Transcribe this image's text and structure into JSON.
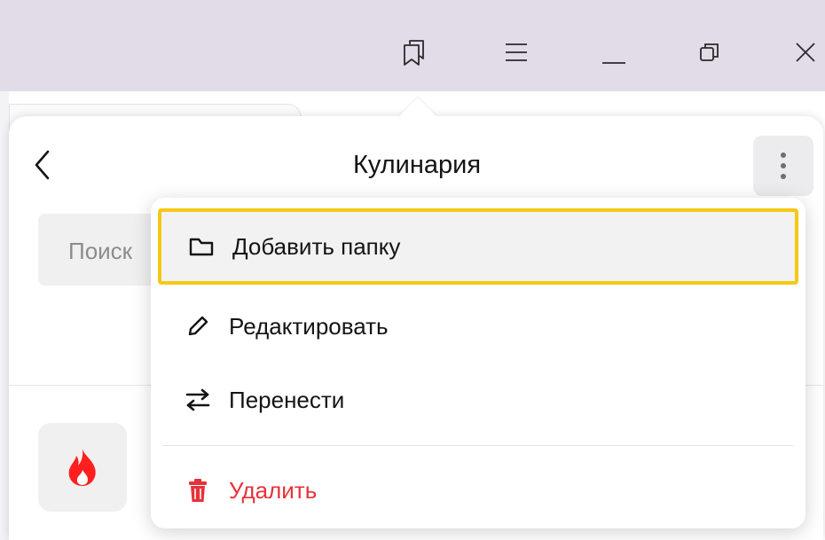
{
  "titlebar": {
    "buttons": [
      {
        "name": "bookmarks-icon"
      },
      {
        "name": "menu-icon"
      },
      {
        "name": "minimize-icon"
      },
      {
        "name": "restore-icon"
      },
      {
        "name": "close-icon"
      }
    ]
  },
  "panel": {
    "title": "Кулинария",
    "search": {
      "placeholder": "Поиск"
    }
  },
  "context_menu": {
    "items": [
      {
        "label": "Добавить папку",
        "icon": "folder-icon",
        "highlighted": true
      },
      {
        "label": "Редактировать",
        "icon": "pencil-icon"
      },
      {
        "label": "Перенести",
        "icon": "swap-arrows-icon"
      },
      {
        "label": "Удалить",
        "icon": "trash-icon",
        "danger": true
      }
    ]
  },
  "colors": {
    "titlebar_bg": "#e2dbe8",
    "highlight_border": "#f5c815",
    "danger": "#e6323a",
    "fire": "#ff1f1f"
  }
}
